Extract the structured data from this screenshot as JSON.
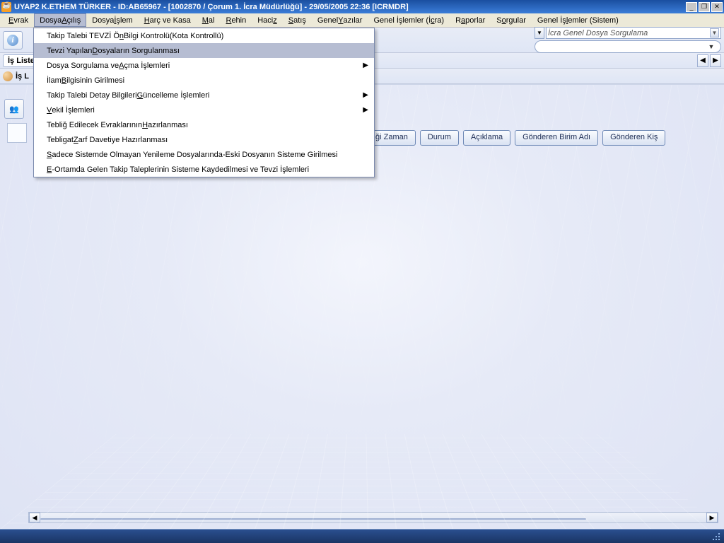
{
  "title": "UYAP2   K.ETHEM TÜRKER  -  ID:AB65967 - [1002870 / Çorum 1. İcra Müdürlüğü] - 29/05/2005 22:36 [ICRMDR]",
  "menu": {
    "items": [
      {
        "pre": "",
        "ul": "E",
        "post": "vrak"
      },
      {
        "pre": "Dosya ",
        "ul": "A",
        "post": "çılış"
      },
      {
        "pre": "Dosya ",
        "ul": "İ",
        "post": "şlem"
      },
      {
        "pre": "",
        "ul": "H",
        "post": "arç ve Kasa"
      },
      {
        "pre": "",
        "ul": "M",
        "post": "al"
      },
      {
        "pre": "",
        "ul": "R",
        "post": "ehin"
      },
      {
        "pre": "Haci",
        "ul": "z",
        "post": ""
      },
      {
        "pre": "",
        "ul": "S",
        "post": "atış"
      },
      {
        "pre": "Genel ",
        "ul": "Y",
        "post": "azılar"
      },
      {
        "pre": "Genel İşlemler (İ",
        "ul": "c",
        "post": "ra)"
      },
      {
        "pre": "R",
        "ul": "a",
        "post": "porlar"
      },
      {
        "pre": "S",
        "ul": "o",
        "post": "rgular"
      },
      {
        "pre": "Genel İş",
        "ul": "l",
        "post": "emler (Sistem)"
      }
    ],
    "open_index": 1
  },
  "dropdown": {
    "items": [
      {
        "pre": "Takip Talebi TEVZİ Ö",
        "ul": "n",
        "post": "Bilgi Kontrolü(Kota Kontrollü)",
        "arrow": false,
        "hover": false
      },
      {
        "pre": "Tevzi Yapılan ",
        "ul": "D",
        "post": "osyaların Sorgulanması",
        "arrow": false,
        "hover": true
      },
      {
        "pre": "Dosya Sorgulama ve ",
        "ul": "A",
        "post": "çma İşlemleri",
        "arrow": true,
        "hover": false
      },
      {
        "pre": "İlam ",
        "ul": "B",
        "post": "ilgisinin Girilmesi",
        "arrow": false,
        "hover": false
      },
      {
        "pre": "Takip Talebi Detay Bilgileri ",
        "ul": "G",
        "post": "üncelleme İşlemleri",
        "arrow": true,
        "hover": false
      },
      {
        "pre": "",
        "ul": "V",
        "post": "ekil İşlemleri",
        "arrow": true,
        "hover": false
      },
      {
        "pre": "Tebliğ Edilecek Evraklarının ",
        "ul": "H",
        "post": "azırlanması",
        "arrow": false,
        "hover": false
      },
      {
        "pre": "Tebligat ",
        "ul": "Z",
        "post": "arf Davetiye Hazırlanması",
        "arrow": false,
        "hover": false
      },
      {
        "pre": "",
        "ul": "S",
        "post": "adece Sistemde Olmayan Yenileme Dosyalarında-Eski Dosyanın Sisteme Girilmesi",
        "arrow": false,
        "hover": false
      },
      {
        "pre": "",
        "ul": "E",
        "post": "-Ortamda Gelen Takip Taleplerinin Sisteme Kaydedilmesi ve Tevzi İşlemleri",
        "arrow": false,
        "hover": false
      }
    ]
  },
  "combo_top": "İcra Genel Dosya Sorgulama",
  "tab_left": "İş Liste",
  "tab_inner": "İş L",
  "i_letter": "i",
  "columns": [
    "ği Zaman",
    "Durum",
    "Açıklama",
    "Gönderen Birim Adı",
    "Gönderen Kiş"
  ],
  "win": {
    "min": "_",
    "max": "❐",
    "close": "✕"
  },
  "arrows": {
    "left": "◀",
    "right": "▶",
    "down": "▼",
    "sub": "▶"
  }
}
